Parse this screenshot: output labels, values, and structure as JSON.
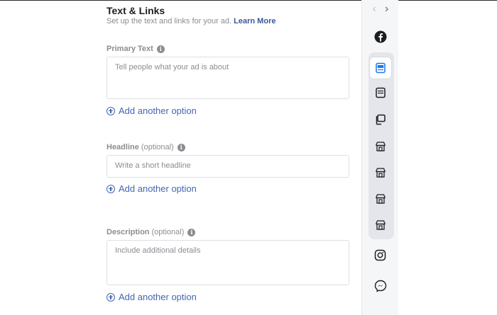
{
  "section": {
    "title": "Text & Links",
    "subtitle": "Set up the text and links for your ad.",
    "learn_more": "Learn More"
  },
  "primary_text": {
    "label": "Primary Text",
    "placeholder": "Tell people what your ad is about",
    "value": ""
  },
  "headline": {
    "label": "Headline",
    "optional": "(optional)",
    "placeholder": "Write a short headline",
    "value": ""
  },
  "description": {
    "label": "Description",
    "optional": "(optional)",
    "placeholder": "Include additional details",
    "value": ""
  },
  "add_option_label": "Add another option",
  "info_glyph": "i",
  "nav": {
    "prev": "‹",
    "next": "›"
  },
  "placements": [
    {
      "icon": "facebook-icon",
      "active": false
    },
    {
      "icon": "feed-placement-icon",
      "active": true
    },
    {
      "icon": "stories-placement-icon",
      "active": false
    },
    {
      "icon": "instant-article-icon",
      "active": false
    },
    {
      "icon": "marketplace-icon",
      "active": false
    },
    {
      "icon": "marketplace-icon",
      "active": false
    },
    {
      "icon": "marketplace-icon",
      "active": false
    },
    {
      "icon": "marketplace-icon",
      "active": false
    },
    {
      "icon": "instagram-icon",
      "active": false
    },
    {
      "icon": "messenger-icon",
      "active": false
    }
  ],
  "colors": {
    "link": "#4267b2",
    "label": "#8a8d91",
    "active_icon": "#1877f2"
  }
}
